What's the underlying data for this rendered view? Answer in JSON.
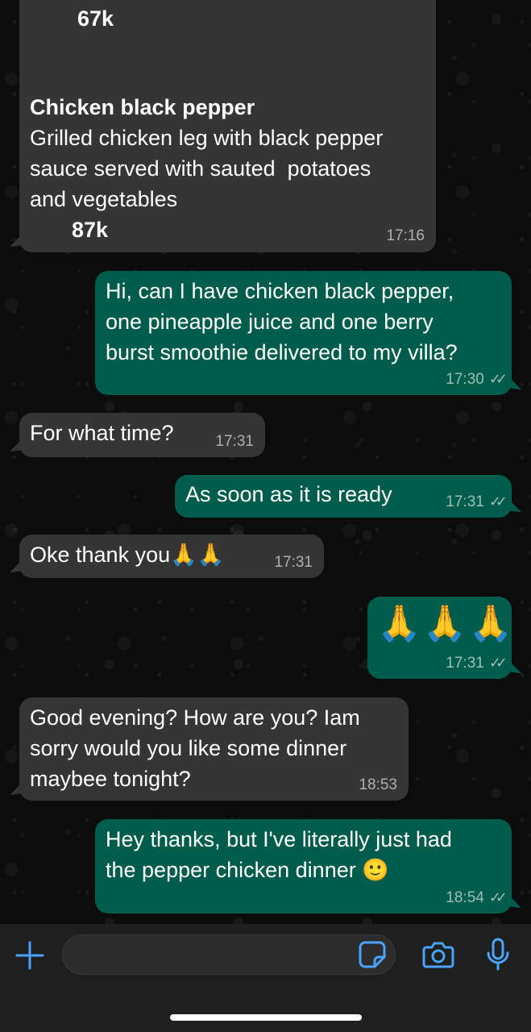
{
  "messages": {
    "m1": {
      "price_top": "67k",
      "title": "Chicken black pepper",
      "line1": "Grilled chicken leg with black pepper",
      "line2": "sauce served with sauted  potatoes",
      "line3": "and vegetables",
      "price": "87k",
      "time": "17:16",
      "direction": "incoming"
    },
    "m2": {
      "line1": "Hi, can I have chicken black pepper,",
      "line2": "one pineapple juice and one berry",
      "line3": "burst smoothie delivered to my villa?",
      "time": "17:30",
      "direction": "outgoing",
      "status": "read"
    },
    "m3": {
      "text": "For what time?",
      "time": "17:31",
      "direction": "incoming"
    },
    "m4": {
      "text": "As soon as it is ready",
      "time": "17:31",
      "direction": "outgoing",
      "status": "read"
    },
    "m5": {
      "text": "Oke thank you",
      "emoji": "🙏🙏",
      "time": "17:31",
      "direction": "incoming"
    },
    "m6": {
      "emoji": "🙏🙏🙏",
      "time": "17:31",
      "direction": "outgoing",
      "status": "read"
    },
    "m7": {
      "line1": "Good evening? How are you? Iam",
      "line2": "sorry would you like some dinner",
      "line3": "maybee tonight?",
      "time": "18:53",
      "direction": "incoming"
    },
    "m8": {
      "line1": "Hey thanks, but I've literally just had",
      "line2": "the pepper chicken dinner",
      "emoji": "🙂",
      "time": "18:54",
      "direction": "outgoing",
      "status": "read"
    }
  },
  "read_ticks": "✓✓",
  "input_bar": {
    "icons": [
      "plus-icon",
      "sticker-icon",
      "camera-icon",
      "microphone-icon"
    ]
  },
  "colors": {
    "incoming_bubble": "#353535",
    "outgoing_bubble": "#005c4b",
    "accent": "#4aa3ff",
    "input_bar": "#1f1f1f"
  }
}
